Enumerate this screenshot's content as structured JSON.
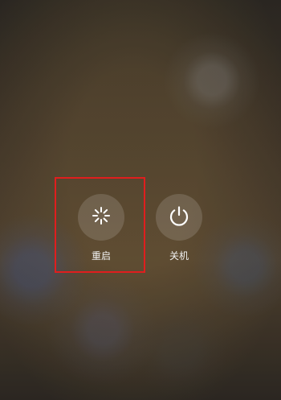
{
  "power_menu": {
    "restart": {
      "label": "重启",
      "icon": "restart-icon"
    },
    "poweroff": {
      "label": "关机",
      "icon": "power-icon"
    }
  },
  "colors": {
    "highlight": "#e01e1e",
    "label": "#f1f1f1",
    "button_fill": "rgba(255,255,255,0.14)"
  }
}
